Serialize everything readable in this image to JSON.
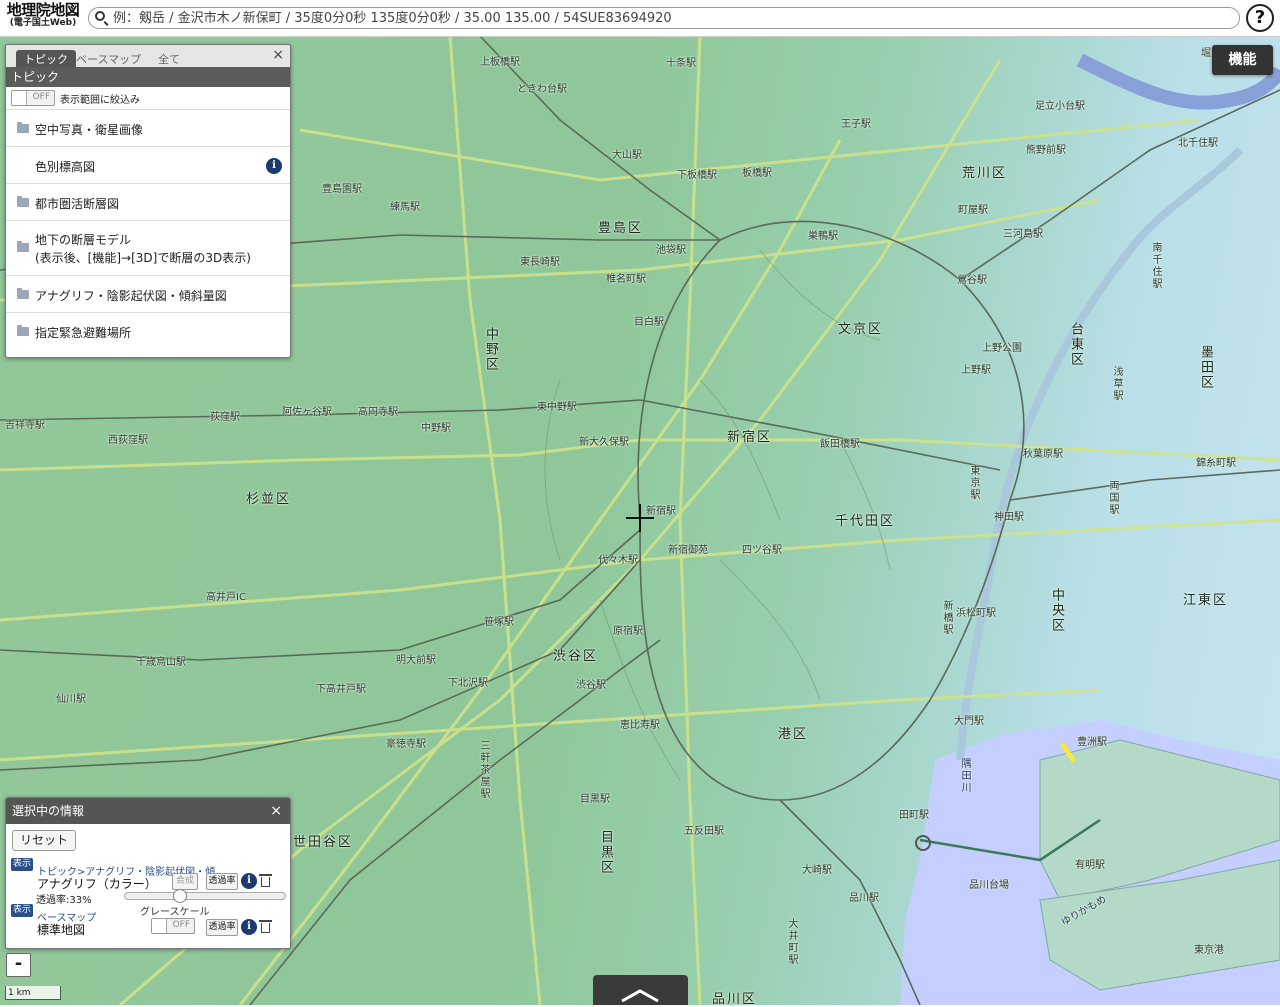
{
  "header": {
    "logo_main": "地理院地図",
    "logo_sub": "(電子国土Web)",
    "search_placeholder": "例：剱岳 / 金沢市木ノ新保町 / 35度0分0秒 135度0分0秒 / 35.00 135.00 / 54SUE83694920",
    "help_label": "?"
  },
  "function_button": "機能",
  "topic_panel": {
    "tabs": [
      "トピック",
      "ベースマップ",
      "全て"
    ],
    "title": "トピック",
    "close": "×",
    "filter_toggle": "OFF",
    "filter_label": "表示範囲に絞込み",
    "items": [
      {
        "label": "空中写真・衛星画像"
      },
      {
        "label": "色別標高図"
      },
      {
        "label": "都市圏活断層図"
      },
      {
        "label_line1": "地下の断層モデル",
        "label_line2": "(表示後、[機能]→[3D]で断層の3D表示)"
      },
      {
        "label": "アナグリフ・陰影起伏図・傾斜量図"
      },
      {
        "label": "指定緊急避難場所"
      }
    ]
  },
  "selected_panel": {
    "title": "選択中の情報",
    "close": "×",
    "reset": "リセット",
    "layers": [
      {
        "badge": "表示",
        "path": "トピック>アナグリフ・陰影起伏図・傾",
        "name": "アナグリフ（カラー）",
        "combine": "合成",
        "transparency_btn": "透過率",
        "opacity_label": "透過率:33%",
        "opacity": 0.33
      },
      {
        "badge": "表示",
        "path": "ベースマップ",
        "grayscale_label": "グレースケール",
        "name": "標準地図",
        "toggle": "OFF",
        "transparency_btn": "透過率"
      }
    ]
  },
  "zoom_out": "-",
  "scale_label": "1 km",
  "map": {
    "wards": [
      "豊島区",
      "文京区",
      "台東区",
      "墨田区",
      "荒川区",
      "中野区",
      "杉並区",
      "新宿区",
      "千代田区",
      "中央区",
      "江東区",
      "渋谷区",
      "港区",
      "目黒区",
      "世田谷区",
      "品川区"
    ],
    "stations": [
      "上板橋駅",
      "ときわ台駅",
      "十条駅",
      "王子駅",
      "大山駅",
      "下板橋駅",
      "板橋駅",
      "巣鴨駅",
      "池袋駅",
      "椎名町駅",
      "目白駅",
      "東長崎駅",
      "練馬駅",
      "豊島園駅",
      "上野駅",
      "上野公園",
      "鶯谷駅",
      "南千住駅",
      "三河島駅",
      "町屋駅",
      "北千住駅",
      "熊野前駅",
      "足立小台駅",
      "堀大橋駅",
      "東中野駅",
      "新大久保駅",
      "飯田橋駅",
      "新宿駅",
      "新宿御苑",
      "代々木駅",
      "四ツ谷駅",
      "東京駅",
      "神田駅",
      "秋葉原駅",
      "浅草駅",
      "両国駅",
      "錦糸町駅",
      "荻窪駅",
      "阿佐ヶ谷駅",
      "高円寺駅",
      "中野駅",
      "西荻窪駅",
      "吉祥寺駅",
      "高井戸IC",
      "千歳烏山駅",
      "仙川駅",
      "明大前駅",
      "下高井戸駅",
      "下北沢駅",
      "笹塚駅",
      "原宿駅",
      "渋谷駅",
      "恵比寿駅",
      "新橋駅",
      "浜松町駅",
      "豪徳寺駅",
      "三軒茶屋駅",
      "目黒駅",
      "五反田駅",
      "大崎駅",
      "品川駅",
      "大井町駅",
      "豊洲駅",
      "有明駅",
      "東京港",
      "品川台場",
      "田町駅",
      "大門駅"
    ],
    "water": [
      "隅田川",
      "ゆりかもめ"
    ],
    "colors": {
      "land": "#93c79a",
      "water": "#c5cfff",
      "road": "#cfe389",
      "rail": "#5a6a5a"
    }
  }
}
